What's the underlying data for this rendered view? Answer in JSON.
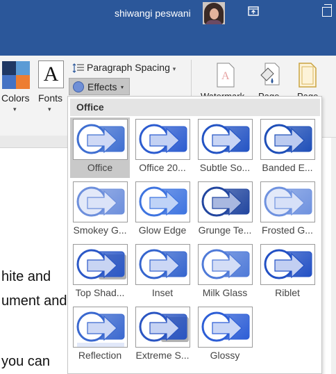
{
  "titlebar": {
    "user_name": "shiwangi peswani",
    "accent": "#2b579a"
  },
  "ribbon": {
    "colors_label": "Colors",
    "fonts_label": "Fonts",
    "fonts_icon_glyph": "A",
    "paragraph_spacing_label": "Paragraph Spacing",
    "effects_label": "Effects",
    "watermark_label": "Watermark",
    "page_color_label": "Page",
    "page_borders_label": "Page",
    "caret": "▾"
  },
  "document": {
    "lines": [
      "hite and",
      "ument and",
      "you can"
    ]
  },
  "effects_menu": {
    "header": "Office",
    "items": [
      {
        "label": "Office",
        "style": "office",
        "selected": true
      },
      {
        "label": "Office 20...",
        "style": "office2013"
      },
      {
        "label": "Subtle So...",
        "style": "subtle"
      },
      {
        "label": "Banded E...",
        "style": "banded"
      },
      {
        "label": "Smokey G...",
        "style": "smokey"
      },
      {
        "label": "Glow Edge",
        "style": "glow"
      },
      {
        "label": "Grunge Te...",
        "style": "grunge"
      },
      {
        "label": "Frosted G...",
        "style": "frosted"
      },
      {
        "label": "Top Shad...",
        "style": "topshadow"
      },
      {
        "label": "Inset",
        "style": "inset"
      },
      {
        "label": "Milk Glass",
        "style": "milk"
      },
      {
        "label": "Riblet",
        "style": "riblet"
      },
      {
        "label": "Reflection",
        "style": "reflection"
      },
      {
        "label": "Extreme S...",
        "style": "extreme"
      },
      {
        "label": "Glossy",
        "style": "glossy"
      }
    ]
  },
  "icons": {
    "avatar": "user-avatar",
    "ribbon_display": "ribbon-display-options-icon",
    "restore": "restore-window-icon",
    "effects": "effects-circle-icon",
    "paragraph": "paragraph-spacing-icon"
  },
  "colors": {
    "blue": "#2b579a",
    "effect_blue": "#2f5fc8",
    "effect_light": "#aebde9"
  }
}
